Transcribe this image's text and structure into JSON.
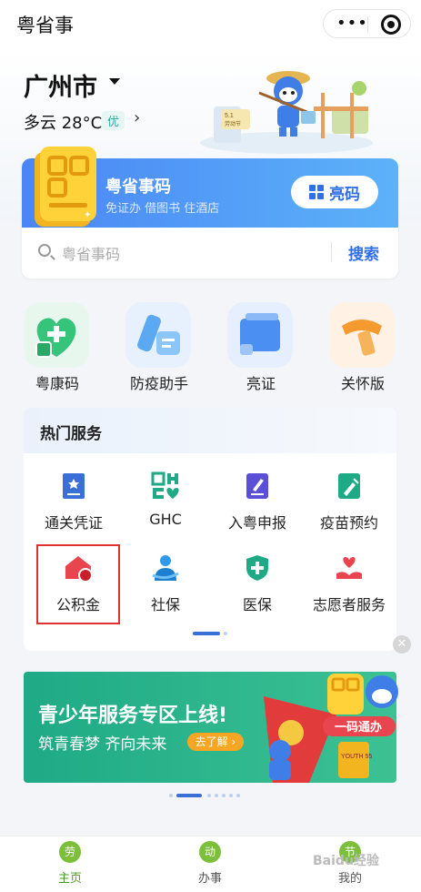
{
  "app": {
    "title": "粤省事"
  },
  "location": {
    "city": "广州市",
    "weather": "多云 28°C",
    "aqi": "优"
  },
  "mascot": {
    "sign": "5.1 劳动节"
  },
  "code_card": {
    "title": "粤省事码",
    "subtitle": "免证办 借图书 住酒店",
    "show_button": "亮码"
  },
  "search": {
    "placeholder": "粤省事码",
    "button": "搜索"
  },
  "quick_apps": [
    {
      "label": "粤康码",
      "color": "#4cc27a"
    },
    {
      "label": "防疫助手",
      "color": "#5aa9f2"
    },
    {
      "label": "亮证",
      "color": "#4a8ff1"
    },
    {
      "label": "关怀版",
      "color": "#f59a2e"
    }
  ],
  "hot_services": {
    "title": "热门服务",
    "items": [
      {
        "label": "通关凭证",
        "icon": "passport-icon"
      },
      {
        "label": "GHC",
        "icon": "ghc-icon"
      },
      {
        "label": "入粤申报",
        "icon": "declare-icon"
      },
      {
        "label": "疫苗预约",
        "icon": "vaccine-icon"
      },
      {
        "label": "公积金",
        "icon": "housing-fund-icon"
      },
      {
        "label": "社保",
        "icon": "social-security-icon"
      },
      {
        "label": "医保",
        "icon": "medical-insurance-icon"
      },
      {
        "label": "志愿者服务",
        "icon": "volunteer-icon"
      }
    ]
  },
  "promo": {
    "title": "青少年服务专区上线!",
    "subtitle": "筑青春梦 齐向未来",
    "button": "去了解",
    "badge": "一码通办",
    "shirt": "YOUTH 55"
  },
  "bottom_nav": [
    {
      "label": "主页",
      "icon_text": "劳",
      "active": true
    },
    {
      "label": "办事",
      "icon_text": "动",
      "active": false
    },
    {
      "label": "我的",
      "icon_text": "节",
      "active": false
    }
  ],
  "watermark": "Baidu经验"
}
